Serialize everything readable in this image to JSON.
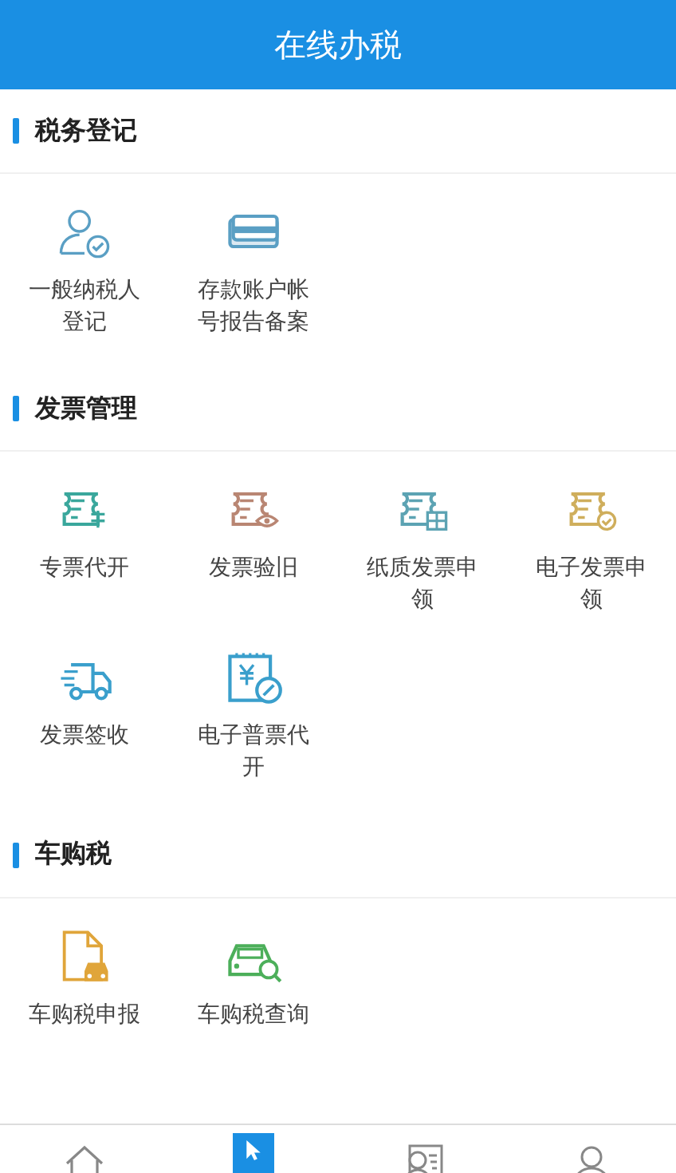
{
  "header": {
    "title": "在线办税"
  },
  "sections": [
    {
      "title": "税务登记",
      "items": [
        {
          "label": "一般纳税人登记",
          "kind": "user-check",
          "color": "#5a9fc4"
        },
        {
          "label": "存款账户帐号报告备案",
          "kind": "card",
          "color": "#5a9fc4"
        }
      ]
    },
    {
      "title": "发票管理",
      "items": [
        {
          "label": "专票代开",
          "kind": "ticket-special",
          "color": "#3aa79c"
        },
        {
          "label": "发票验旧",
          "kind": "ticket-eye",
          "color": "#b98673"
        },
        {
          "label": "纸质发票申领",
          "kind": "ticket-grid",
          "color": "#5ca3b3"
        },
        {
          "label": "电子发票申领",
          "kind": "ticket-check",
          "color": "#cfae5c"
        },
        {
          "label": "发票签收",
          "kind": "truck",
          "color": "#3a9fcc"
        },
        {
          "label": "电子普票代开",
          "kind": "receipt",
          "color": "#3a9fcc"
        }
      ]
    },
    {
      "title": "车购税",
      "items": [
        {
          "label": "车购税申报",
          "kind": "doc-car",
          "color": "#e0a53a"
        },
        {
          "label": "车购税查询",
          "kind": "car-search",
          "color": "#4caf5a"
        }
      ]
    }
  ],
  "tabs": [
    {
      "kind": "home",
      "selected": false
    },
    {
      "kind": "cursor",
      "selected": true
    },
    {
      "kind": "contact",
      "selected": false
    },
    {
      "kind": "person",
      "selected": false
    }
  ]
}
